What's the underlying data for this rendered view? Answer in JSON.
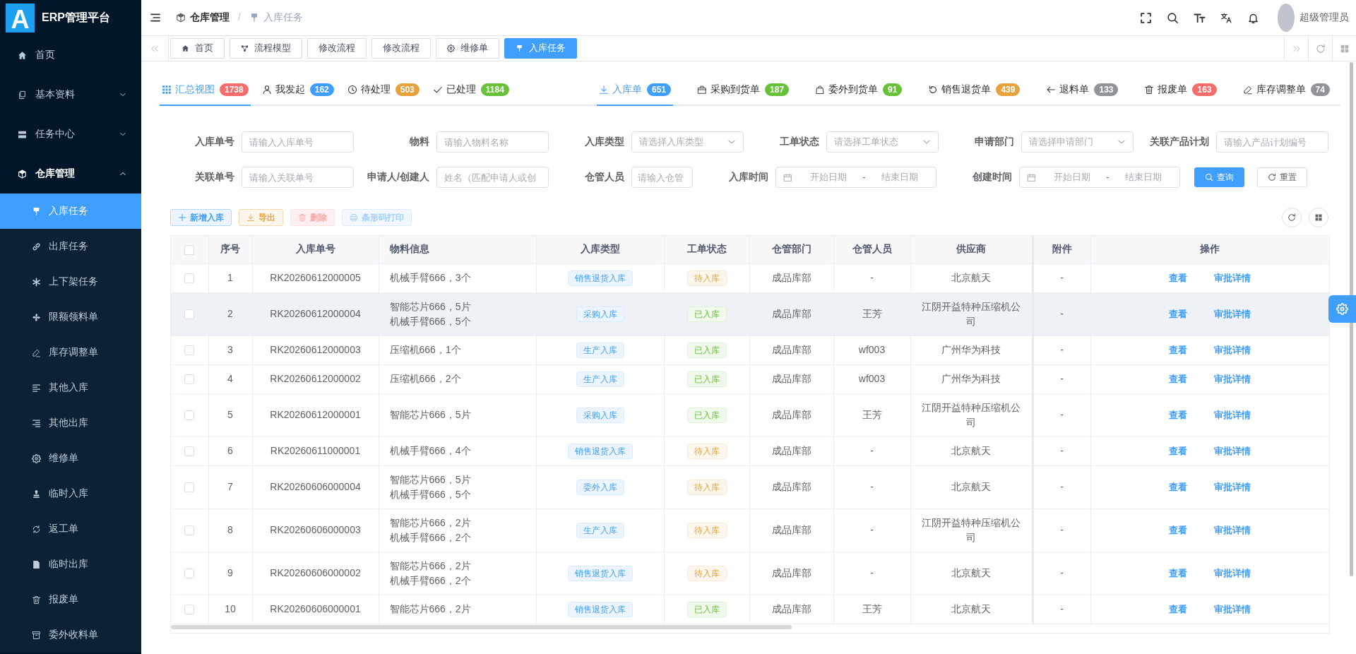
{
  "sidebar": {
    "logo": "A",
    "title": "ERP管理平台",
    "items": [
      {
        "label": "首页",
        "selected": false
      },
      {
        "label": "基本资料",
        "selected": false,
        "expanded": false
      },
      {
        "label": "任务中心",
        "selected": false,
        "expanded": false
      },
      {
        "label": "仓库管理",
        "selected": false,
        "expanded": true,
        "children": [
          {
            "label": "入库任务",
            "selected": true
          },
          {
            "label": "出库任务",
            "selected": false
          },
          {
            "label": "上下架任务",
            "selected": false
          },
          {
            "label": "限额领料单",
            "selected": false
          },
          {
            "label": "库存调整单",
            "selected": false
          },
          {
            "label": "其他入库",
            "selected": false
          },
          {
            "label": "其他出库",
            "selected": false
          },
          {
            "label": "维修单",
            "selected": false
          },
          {
            "label": "临时入库",
            "selected": false
          },
          {
            "label": "返工单",
            "selected": false
          },
          {
            "label": "临时出库",
            "selected": false
          },
          {
            "label": "报废单",
            "selected": false
          },
          {
            "label": "委外收料单",
            "selected": false
          }
        ]
      }
    ]
  },
  "header": {
    "breadcrumb": [
      {
        "label": "仓库管理"
      },
      {
        "label": "入库任务"
      }
    ],
    "breadcrumb_separator": "/",
    "user": "超级管理员"
  },
  "tags_bar": [
    {
      "label": "首页",
      "selected": false
    },
    {
      "label": "流程模型",
      "selected": false
    },
    {
      "label": "修改流程",
      "selected": false
    },
    {
      "label": "修改流程",
      "selected": false
    },
    {
      "label": "维修单",
      "selected": false
    },
    {
      "label": "入库任务",
      "selected": true
    }
  ],
  "view_tabs": [
    {
      "label": "汇总视图",
      "count": "1738",
      "color": "#f56c6c",
      "selected": true
    },
    {
      "label": "我发起",
      "count": "162",
      "color": "#409eff",
      "selected": false
    },
    {
      "label": "待处理",
      "count": "503",
      "color": "#e6a23c",
      "selected": false
    },
    {
      "label": "已处理",
      "count": "1184",
      "color": "#67c23a",
      "selected": false
    }
  ],
  "type_tabs": [
    {
      "label": "入库单",
      "count": "651",
      "color": "#409eff",
      "selected": true
    },
    {
      "label": "采购到货单",
      "count": "187",
      "color": "#67c23a",
      "selected": false
    },
    {
      "label": "委外到货单",
      "count": "91",
      "color": "#67c23a",
      "selected": false
    },
    {
      "label": "销售退货单",
      "count": "439",
      "color": "#e6a23c",
      "selected": false
    },
    {
      "label": "退料单",
      "count": "133",
      "color": "#909399",
      "selected": false
    },
    {
      "label": "报废单",
      "count": "163",
      "color": "#f56c6c",
      "selected": false
    },
    {
      "label": "库存调整单",
      "count": "74",
      "color": "#909399",
      "selected": false
    }
  ],
  "filters": {
    "rows": [
      [
        {
          "label": "入库单号",
          "kind": "input",
          "placeholder": "请输入入库单号"
        },
        {
          "label": "物料",
          "kind": "input",
          "placeholder": "请输入物料名称"
        },
        {
          "label": "入库类型",
          "kind": "select",
          "placeholder": "请选择入库类型"
        },
        {
          "label": "工单状态",
          "kind": "select",
          "placeholder": "请选择工单状态"
        },
        {
          "label": "申请部门",
          "kind": "select",
          "placeholder": "请选择申请部门"
        },
        {
          "label": "关联产品计划",
          "kind": "input",
          "placeholder": "请输入产品计划编号"
        }
      ],
      [
        {
          "label": "关联单号",
          "kind": "input",
          "placeholder": "请输入关联单号"
        },
        {
          "label": "申请人/创建人",
          "kind": "input",
          "placeholder": "姓名（匹配申请人或创"
        },
        {
          "label": "仓管人员",
          "kind": "input",
          "placeholder": "请输入仓管"
        },
        {
          "label": "入库时间",
          "kind": "daterange",
          "start_placeholder": "开始日期",
          "separator": "-",
          "end_placeholder": "结束日期"
        },
        {
          "label": "创建时间",
          "kind": "daterange",
          "start_placeholder": "开始日期",
          "separator": "-",
          "end_placeholder": "结束日期"
        }
      ]
    ],
    "buttons": [
      {
        "label": "查询",
        "kind": "primary"
      },
      {
        "label": "重置",
        "kind": "default"
      }
    ]
  },
  "toolbar": {
    "buttons": [
      {
        "label": "新增入库",
        "kind": "primary",
        "disabled": false
      },
      {
        "label": "导出",
        "kind": "warning",
        "disabled": false
      },
      {
        "label": "删除",
        "kind": "danger",
        "disabled": true
      },
      {
        "label": "条形码打印",
        "kind": "primary",
        "disabled": true
      }
    ]
  },
  "table": {
    "select_all": {
      "checked": false
    },
    "columns": [
      "序号",
      "入库单号",
      "物料信息",
      "入库类型",
      "工单状态",
      "仓管部门",
      "仓管人员",
      "供应商",
      "附件",
      "操作"
    ],
    "rows": [
      {
        "checked": false,
        "highlighted": false,
        "no": "1",
        "code": "RK20260612000005",
        "materials": [
          "机械手臂666，3个"
        ],
        "type": "销售退货入库",
        "status": {
          "text": "待入库",
          "kind": "warning"
        },
        "dept": "成品库部",
        "keeper": "-",
        "supplier": "北京航天",
        "attachment": "-",
        "actions": [
          "查看",
          "审批详情"
        ]
      },
      {
        "checked": false,
        "highlighted": true,
        "no": "2",
        "code": "RK20260612000004",
        "materials": [
          "智能芯片666，5片",
          "机械手臂666，5个"
        ],
        "type": "采购入库",
        "status": {
          "text": "已入库",
          "kind": "success"
        },
        "dept": "成品库部",
        "keeper": "王芳",
        "supplier": "江阴开益特种压缩机公司",
        "attachment": "-",
        "actions": [
          "查看",
          "审批详情"
        ]
      },
      {
        "checked": false,
        "highlighted": false,
        "no": "3",
        "code": "RK20260612000003",
        "materials": [
          "压缩机666，1个"
        ],
        "type": "生产入库",
        "status": {
          "text": "已入库",
          "kind": "success"
        },
        "dept": "成品库部",
        "keeper": "wf003",
        "supplier": "广州华为科技",
        "attachment": "-",
        "actions": [
          "查看",
          "审批详情"
        ]
      },
      {
        "checked": false,
        "highlighted": false,
        "no": "4",
        "code": "RK20260612000002",
        "materials": [
          "压缩机666，2个"
        ],
        "type": "生产入库",
        "status": {
          "text": "已入库",
          "kind": "success"
        },
        "dept": "成品库部",
        "keeper": "wf003",
        "supplier": "广州华为科技",
        "attachment": "-",
        "actions": [
          "查看",
          "审批详情"
        ]
      },
      {
        "checked": false,
        "highlighted": false,
        "no": "5",
        "code": "RK20260612000001",
        "materials": [
          "智能芯片666，5片"
        ],
        "type": "采购入库",
        "status": {
          "text": "已入库",
          "kind": "success"
        },
        "dept": "成品库部",
        "keeper": "王芳",
        "supplier": "江阴开益特种压缩机公司",
        "attachment": "-",
        "actions": [
          "查看",
          "审批详情"
        ]
      },
      {
        "checked": false,
        "highlighted": false,
        "no": "6",
        "code": "RK20260611000001",
        "materials": [
          "机械手臂666，4个"
        ],
        "type": "销售退货入库",
        "status": {
          "text": "待入库",
          "kind": "warning"
        },
        "dept": "成品库部",
        "keeper": "-",
        "supplier": "北京航天",
        "attachment": "-",
        "actions": [
          "查看",
          "审批详情"
        ]
      },
      {
        "checked": false,
        "highlighted": false,
        "no": "7",
        "code": "RK20260606000004",
        "materials": [
          "智能芯片666，5片",
          "机械手臂666，5个"
        ],
        "type": "委外入库",
        "status": {
          "text": "待入库",
          "kind": "warning"
        },
        "dept": "成品库部",
        "keeper": "-",
        "supplier": "北京航天",
        "attachment": "-",
        "actions": [
          "查看",
          "审批详情"
        ]
      },
      {
        "checked": false,
        "highlighted": false,
        "no": "8",
        "code": "RK20260606000003",
        "materials": [
          "智能芯片666，2片",
          "机械手臂666，2个"
        ],
        "type": "生产入库",
        "status": {
          "text": "待入库",
          "kind": "warning"
        },
        "dept": "成品库部",
        "keeper": "-",
        "supplier": "江阴开益特种压缩机公司",
        "attachment": "-",
        "actions": [
          "查看",
          "审批详情"
        ]
      },
      {
        "checked": false,
        "highlighted": false,
        "no": "9",
        "code": "RK20260606000002",
        "materials": [
          "智能芯片666，2片",
          "机械手臂666，2个"
        ],
        "type": "销售退货入库",
        "status": {
          "text": "待入库",
          "kind": "warning"
        },
        "dept": "成品库部",
        "keeper": "-",
        "supplier": "北京航天",
        "attachment": "-",
        "actions": [
          "查看",
          "审批详情"
        ]
      },
      {
        "checked": false,
        "highlighted": false,
        "no": "10",
        "code": "RK20260606000001",
        "materials": [
          "智能芯片666，2片"
        ],
        "type": "销售退货入库",
        "status": {
          "text": "已入库",
          "kind": "success"
        },
        "dept": "成品库部",
        "keeper": "王芳",
        "supplier": "北京航天",
        "attachment": "-",
        "actions": [
          "查看",
          "审批详情"
        ]
      }
    ]
  }
}
